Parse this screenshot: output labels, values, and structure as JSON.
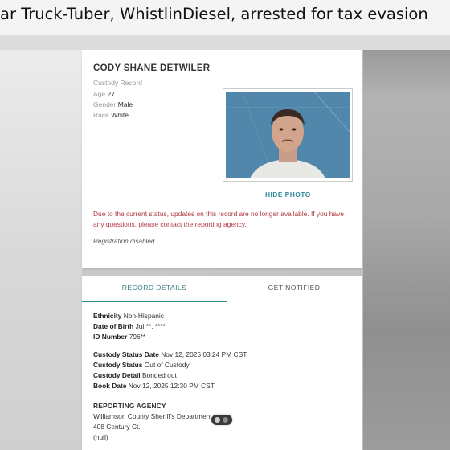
{
  "headline": "ar Truck-Tuber, WhistlinDiesel, arrested for tax evasion",
  "record": {
    "name": "CODY SHANE DETWILER",
    "record_type": "Custody Record",
    "age_label": "Age",
    "age_value": "27",
    "gender_label": "Gender",
    "gender_value": "Male",
    "race_label": "Race",
    "race_value": "White",
    "hide_photo": "HIDE PHOTO",
    "notice": "Due to the current status, updates on this record are no longer available. If you have any questions, please contact the reporting agency.",
    "registration": "Registration disabled"
  },
  "tabs": {
    "record_details": "RECORD DETAILS",
    "get_notified": "GET NOTIFIED"
  },
  "details": {
    "ethnicity_label": "Ethnicity",
    "ethnicity_value": "Non-Hispanic",
    "dob_label": "Date of Birth",
    "dob_value": "Jul **, ****",
    "id_label": "ID Number",
    "id_value": "796**",
    "custody_date_label": "Custody Status Date",
    "custody_date_value": "Nov 12, 2025 03:24 PM CST",
    "custody_status_label": "Custody Status",
    "custody_status_value": "Out of Custody",
    "custody_detail_label": "Custody Detail",
    "custody_detail_value": "Bonded out",
    "book_date_label": "Book Date",
    "book_date_value": "Nov 12, 2025 12:30 PM CST",
    "agency_heading": "REPORTING AGENCY",
    "agency_name": "Williamson County Sheriff's Department",
    "agency_address": "408 Century Ct.",
    "agency_extra": "(null)"
  },
  "colors": {
    "notice_red": "#b0383c",
    "accent_teal": "#2f8a8a",
    "photo_bg": "#4f84a6"
  }
}
